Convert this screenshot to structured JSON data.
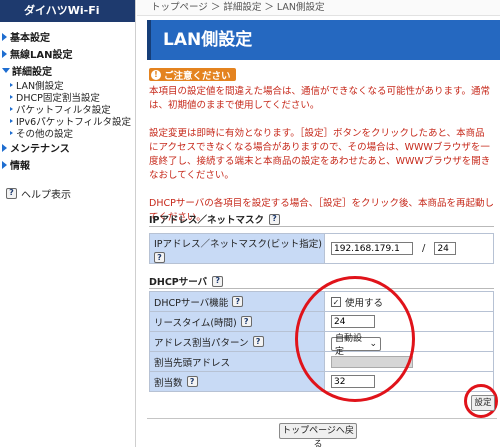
{
  "brand": "ダイハツWi-Fi",
  "sidebar": {
    "items": [
      {
        "label": "基本設定"
      },
      {
        "label": "無線LAN設定"
      },
      {
        "label": "詳細設定"
      },
      {
        "label": "メンテナンス"
      },
      {
        "label": "情報"
      }
    ],
    "sub_items": [
      {
        "label": "LAN側設定"
      },
      {
        "label": "DHCP固定割当設定"
      },
      {
        "label": "パケットフィルタ設定"
      },
      {
        "label": "IPv6パケットフィルタ設定"
      },
      {
        "label": "その他の設定"
      }
    ],
    "help_label": "ヘルプ表示"
  },
  "breadcrumb": "トップページ ＞ 詳細設定 ＞ LAN側設定",
  "page_title": "LAN側設定",
  "notice": {
    "badge": "ご注意ください",
    "paragraphs": [
      "本項目の設定値を間違えた場合は、通信ができなくなる可能性があります。通常は、初期値のままで使用してください。",
      "設定変更は即時に有効となります。［設定］ボタンをクリックしたあと、本商品にアクセスできなくなる場合がありますので、その場合は、WWWブラウザを一度終了し、接続する端末と本商品の設定をあわせたあと、WWWブラウザを開きなおしてください。",
      "DHCPサーバの各項目を設定する場合、［設定］をクリック後、本商品を再起動してください。"
    ]
  },
  "ip_section": {
    "title": "IPアドレス／ネットマスク",
    "label": "IPアドレス／ネットマスク(ビット指定)",
    "ip_value": "192.168.179.1",
    "separator": "/",
    "mask_value": "24"
  },
  "dhcp_section": {
    "title": "DHCPサーバ",
    "rows": {
      "function": {
        "label": "DHCPサーバ機能",
        "check_label": "使用する",
        "checked": true
      },
      "lease": {
        "label": "リースタイム(時間)",
        "value": "24"
      },
      "pattern": {
        "label": "アドレス割当パターン",
        "value": "自動設定"
      },
      "start": {
        "label": "割当先頭アドレス"
      },
      "count": {
        "label": "割当数",
        "value": "32"
      }
    }
  },
  "buttons": {
    "settings": "設定",
    "back_top": "トップページへ戻る"
  },
  "icons": {
    "help": "?",
    "exclamation": "!",
    "check": "✓",
    "chevron": "⌄"
  },
  "colors": {
    "brand_bg": "#1e3a6e",
    "title_bar": "#2568c0",
    "notice_badge": "#e4831f",
    "notice_text": "#c6281a",
    "label_bg": "#c8daf5",
    "annotation_red": "#e0131a"
  }
}
